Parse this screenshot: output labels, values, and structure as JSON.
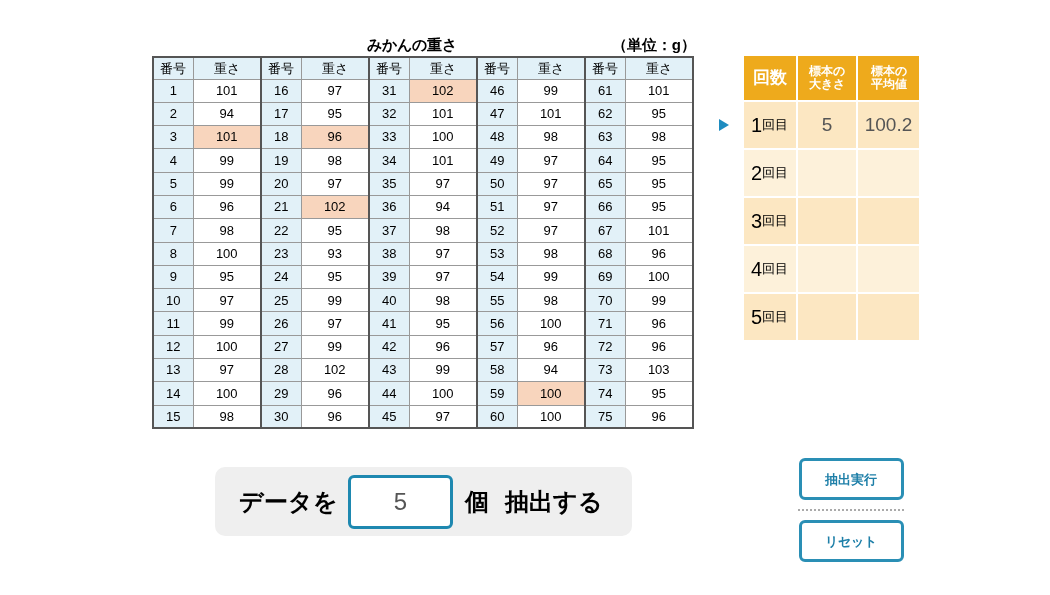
{
  "title": "みかんの重さ",
  "unit": "（単位：g）",
  "table": {
    "groups": [
      {
        "columns": [
          "番号",
          "重さ"
        ],
        "rows": [
          {
            "no": "1",
            "weight": "101",
            "selected": false
          },
          {
            "no": "2",
            "weight": "94",
            "selected": false
          },
          {
            "no": "3",
            "weight": "101",
            "selected": true
          },
          {
            "no": "4",
            "weight": "99",
            "selected": false
          },
          {
            "no": "5",
            "weight": "99",
            "selected": false
          },
          {
            "no": "6",
            "weight": "96",
            "selected": false
          },
          {
            "no": "7",
            "weight": "98",
            "selected": false
          },
          {
            "no": "8",
            "weight": "100",
            "selected": false
          },
          {
            "no": "9",
            "weight": "95",
            "selected": false
          },
          {
            "no": "10",
            "weight": "97",
            "selected": false
          },
          {
            "no": "11",
            "weight": "99",
            "selected": false
          },
          {
            "no": "12",
            "weight": "100",
            "selected": false
          },
          {
            "no": "13",
            "weight": "97",
            "selected": false
          },
          {
            "no": "14",
            "weight": "100",
            "selected": false
          },
          {
            "no": "15",
            "weight": "98",
            "selected": false
          }
        ]
      },
      {
        "columns": [
          "番号",
          "重さ"
        ],
        "rows": [
          {
            "no": "16",
            "weight": "97",
            "selected": false
          },
          {
            "no": "17",
            "weight": "95",
            "selected": false
          },
          {
            "no": "18",
            "weight": "96",
            "selected": true
          },
          {
            "no": "19",
            "weight": "98",
            "selected": false
          },
          {
            "no": "20",
            "weight": "97",
            "selected": false
          },
          {
            "no": "21",
            "weight": "102",
            "selected": true
          },
          {
            "no": "22",
            "weight": "95",
            "selected": false
          },
          {
            "no": "23",
            "weight": "93",
            "selected": false
          },
          {
            "no": "24",
            "weight": "95",
            "selected": false
          },
          {
            "no": "25",
            "weight": "99",
            "selected": false
          },
          {
            "no": "26",
            "weight": "97",
            "selected": false
          },
          {
            "no": "27",
            "weight": "99",
            "selected": false
          },
          {
            "no": "28",
            "weight": "102",
            "selected": false
          },
          {
            "no": "29",
            "weight": "96",
            "selected": false
          },
          {
            "no": "30",
            "weight": "96",
            "selected": false
          }
        ]
      },
      {
        "columns": [
          "番号",
          "重さ"
        ],
        "rows": [
          {
            "no": "31",
            "weight": "102",
            "selected": true
          },
          {
            "no": "32",
            "weight": "101",
            "selected": false
          },
          {
            "no": "33",
            "weight": "100",
            "selected": false
          },
          {
            "no": "34",
            "weight": "101",
            "selected": false
          },
          {
            "no": "35",
            "weight": "97",
            "selected": false
          },
          {
            "no": "36",
            "weight": "94",
            "selected": false
          },
          {
            "no": "37",
            "weight": "98",
            "selected": false
          },
          {
            "no": "38",
            "weight": "97",
            "selected": false
          },
          {
            "no": "39",
            "weight": "97",
            "selected": false
          },
          {
            "no": "40",
            "weight": "98",
            "selected": false
          },
          {
            "no": "41",
            "weight": "95",
            "selected": false
          },
          {
            "no": "42",
            "weight": "96",
            "selected": false
          },
          {
            "no": "43",
            "weight": "99",
            "selected": false
          },
          {
            "no": "44",
            "weight": "100",
            "selected": false
          },
          {
            "no": "45",
            "weight": "97",
            "selected": false
          }
        ]
      },
      {
        "columns": [
          "番号",
          "重さ"
        ],
        "rows": [
          {
            "no": "46",
            "weight": "99",
            "selected": false
          },
          {
            "no": "47",
            "weight": "101",
            "selected": false
          },
          {
            "no": "48",
            "weight": "98",
            "selected": false
          },
          {
            "no": "49",
            "weight": "97",
            "selected": false
          },
          {
            "no": "50",
            "weight": "97",
            "selected": false
          },
          {
            "no": "51",
            "weight": "97",
            "selected": false
          },
          {
            "no": "52",
            "weight": "97",
            "selected": false
          },
          {
            "no": "53",
            "weight": "98",
            "selected": false
          },
          {
            "no": "54",
            "weight": "99",
            "selected": false
          },
          {
            "no": "55",
            "weight": "98",
            "selected": false
          },
          {
            "no": "56",
            "weight": "100",
            "selected": false
          },
          {
            "no": "57",
            "weight": "96",
            "selected": false
          },
          {
            "no": "58",
            "weight": "94",
            "selected": false
          },
          {
            "no": "59",
            "weight": "100",
            "selected": true
          },
          {
            "no": "60",
            "weight": "100",
            "selected": false
          }
        ]
      },
      {
        "columns": [
          "番号",
          "重さ"
        ],
        "rows": [
          {
            "no": "61",
            "weight": "101",
            "selected": false
          },
          {
            "no": "62",
            "weight": "95",
            "selected": false
          },
          {
            "no": "63",
            "weight": "98",
            "selected": false
          },
          {
            "no": "64",
            "weight": "95",
            "selected": false
          },
          {
            "no": "65",
            "weight": "95",
            "selected": false
          },
          {
            "no": "66",
            "weight": "95",
            "selected": false
          },
          {
            "no": "67",
            "weight": "101",
            "selected": false
          },
          {
            "no": "68",
            "weight": "96",
            "selected": false
          },
          {
            "no": "69",
            "weight": "100",
            "selected": false
          },
          {
            "no": "70",
            "weight": "99",
            "selected": false
          },
          {
            "no": "71",
            "weight": "96",
            "selected": false
          },
          {
            "no": "72",
            "weight": "96",
            "selected": false
          },
          {
            "no": "73",
            "weight": "103",
            "selected": false
          },
          {
            "no": "74",
            "weight": "95",
            "selected": false
          },
          {
            "no": "75",
            "weight": "96",
            "selected": false
          }
        ]
      }
    ]
  },
  "results": {
    "columns": [
      "回数",
      "標本の大きさ",
      "標本の平均値"
    ],
    "rows": [
      {
        "number": "1",
        "suffix": "回目",
        "size": "5",
        "mean": "100.2",
        "selected": true
      },
      {
        "number": "2",
        "suffix": "回目",
        "selected": false
      },
      {
        "number": "3",
        "suffix": "回目",
        "selected": false
      },
      {
        "number": "4",
        "suffix": "回目",
        "selected": false
      },
      {
        "number": "5",
        "suffix": "回目",
        "selected": false
      }
    ]
  },
  "extract_panel": {
    "prefix": "データを",
    "value": "5",
    "suffix": "個",
    "action": "抽出する"
  },
  "buttons": [
    "抽出実行",
    "リセット"
  ]
}
